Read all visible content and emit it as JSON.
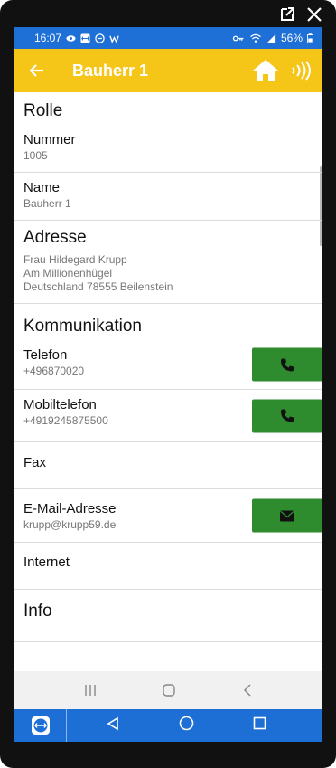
{
  "status_bar": {
    "time": "16:07",
    "battery": "56%"
  },
  "app_bar": {
    "title": "Bauherr 1"
  },
  "sections": {
    "rolle": "Rolle",
    "adresse": "Adresse",
    "kommunikation": "Kommunikation",
    "info": "Info"
  },
  "fields": {
    "nummer": {
      "label": "Nummer",
      "value": "1005"
    },
    "name": {
      "label": "Name",
      "value": "Bauherr 1"
    },
    "address_lines": [
      "Frau Hildegard Krupp",
      "Am Millionenhügel",
      "Deutschland  78555  Beilenstein"
    ],
    "telefon": {
      "label": "Telefon",
      "value": "+496870020"
    },
    "mobil": {
      "label": "Mobiltelefon",
      "value": "+4919245875500"
    },
    "fax": {
      "label": "Fax"
    },
    "email": {
      "label": "E-Mail-Adresse",
      "value": "krupp@krupp59.de"
    },
    "internet": {
      "label": "Internet"
    }
  },
  "colors": {
    "accent": "#f5c518",
    "call_button": "#2e8b2e",
    "status_bar": "#1e6fd6"
  }
}
